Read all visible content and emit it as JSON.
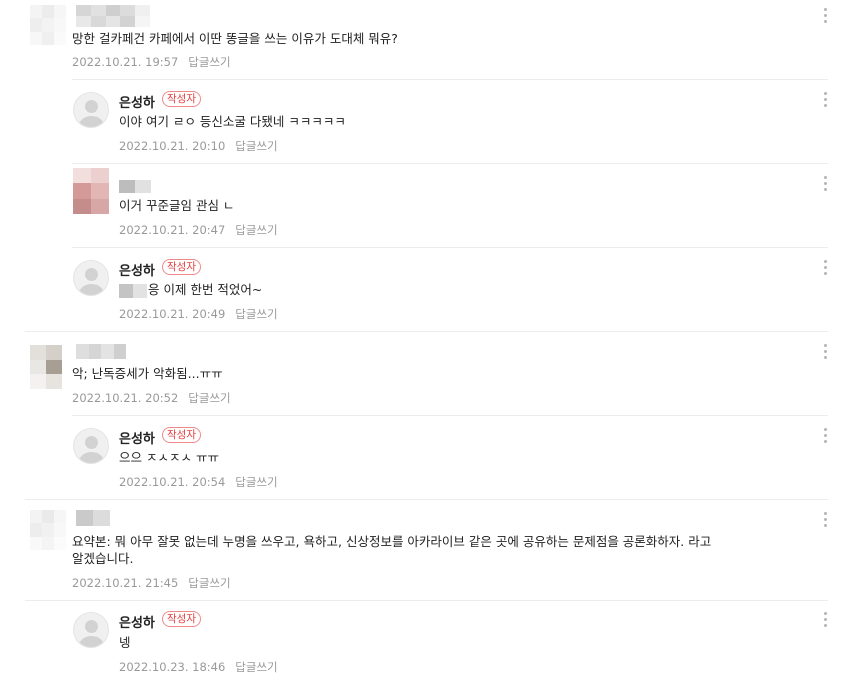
{
  "reply_label": "답글쓰기",
  "author_badge": "작성자",
  "comments": [
    {
      "author": "",
      "text": "망한 걸카페건 카페에서 이딴 똥글을 쓰는 이유가 도대체 뭐유?",
      "date": "2022.10.21. 19:57"
    },
    {
      "author": "은성하",
      "text": "이야 여기 ㄹㅇ 등신소굴 다됐네 ㅋㅋㅋㅋㅋ",
      "date": "2022.10.21. 20:10"
    },
    {
      "author": "",
      "text": "이거 꾸준글임 관심 ㄴ",
      "date": "2022.10.21. 20:47"
    },
    {
      "author": "은성하",
      "text": "응 이제 한번 적었어~",
      "date": "2022.10.21. 20:49"
    },
    {
      "author": "",
      "text": "악; 난독증세가 악화됨...ㅠㅠ",
      "date": "2022.10.21. 20:52"
    },
    {
      "author": "은성하",
      "text": "으으 ㅈㅅㅈㅅ ㅠㅠ",
      "date": "2022.10.21. 20:54"
    },
    {
      "author": "",
      "text_line1": "요약본: 뭐 아무 잘못 없는데 누명을 쓰우고, 욕하고, 신상정보를 아카라이브 같은 곳에 공유하는 문제점을 공론화하자. 라고",
      "text_line2": "알겠습니다.",
      "date": "2022.10.21. 21:45"
    },
    {
      "author": "은성하",
      "text": "넹",
      "date": "2022.10.23. 18:46"
    }
  ]
}
